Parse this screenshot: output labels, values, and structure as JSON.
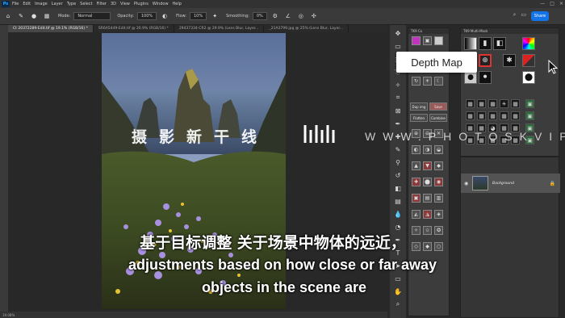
{
  "menu": {
    "logo": "Ps",
    "items": [
      "File",
      "Edit",
      "Image",
      "Layer",
      "Type",
      "Select",
      "Filter",
      "3D",
      "View",
      "Plugins",
      "Window",
      "Help"
    ],
    "window_controls": [
      "—",
      "□",
      "×"
    ]
  },
  "options_bar": {
    "mode_label": "Mode:",
    "mode_value": "Normal",
    "opacity_label": "Opacity:",
    "opacity_value": "100%",
    "flow_label": "Flow:",
    "flow_value": "10%",
    "smoothing_label": "Smoothing:",
    "smoothing_value": "0%",
    "share_label": "Share"
  },
  "tabs": [
    {
      "label": "Ct 20372289-Edit.tif @ 19.1% (RGB/16) *",
      "active": true
    },
    {
      "label": "SR6A5449-Edit.tif @ 20.9% (RGB/16) *",
      "active": false
    },
    {
      "label": "29437334-CR2 @ 29.9% (Lens Blur, Layer...",
      "active": false
    },
    {
      "label": "_21A3799.jpg @ 25% (Lens Blur, Layer...",
      "active": false
    }
  ],
  "status": {
    "zoom": "19.08%"
  },
  "panel_tk": {
    "header": "TK9 Co",
    "buttons": [
      "Dup img",
      "Save",
      "Flatten",
      "Combine"
    ]
  },
  "panel_multimask": {
    "header": "TK9 Multi-Mask"
  },
  "layers": {
    "layer_name": "Background"
  },
  "tooltip": {
    "text": "Depth Map"
  },
  "watermark": {
    "cn": "摄影新干线",
    "logo": "WW",
    "en": "WWW.PHOTOSKVIP"
  },
  "subtitles": {
    "cn": "基于目标调整 关于场景中物体的远近，",
    "en_line1": "adjustments based on how close or far away",
    "en_line2": "objects in the scene are"
  },
  "colors": {
    "accent": "#1473e6",
    "highlight_red": "#c0392b"
  }
}
